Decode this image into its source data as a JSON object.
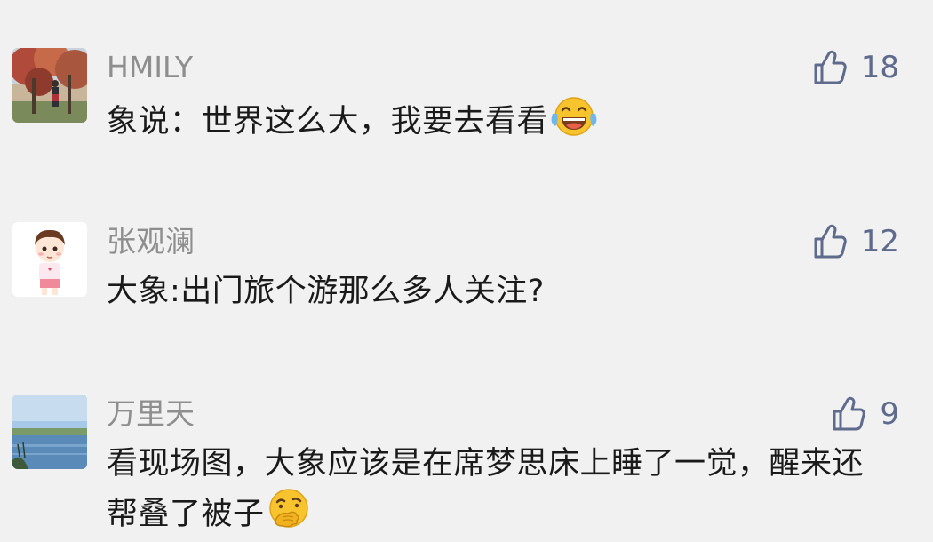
{
  "comments": [
    {
      "username": "HMILY",
      "text": "象说：世界这么大，我要去看看",
      "emoji": "laughing-tears-emoji",
      "likes": "18",
      "avatar": "autumn-trees-photo"
    },
    {
      "username": "张观澜",
      "text": "大象:出门旅个游那么多人关注?",
      "likes": "12",
      "avatar": "cartoon-boy-illustration"
    },
    {
      "username": "万里天",
      "text": "看现场图，大象应该是在席梦思床上睡了一觉，醒来还帮叠了被子",
      "emoji": "thinking-hand-over-mouth-emoji",
      "likes": "9",
      "avatar": "lake-landscape-photo"
    }
  ],
  "colors": {
    "background": "#f1f1f1",
    "username": "#8e8e8e",
    "like": "#5e6b8c",
    "text": "#1a1a1a"
  },
  "icons": {
    "like": "thumbs-up-outline-icon"
  }
}
